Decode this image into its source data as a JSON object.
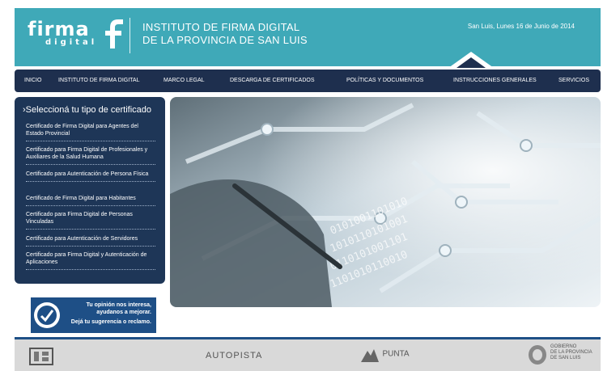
{
  "header": {
    "logo_main": "firma",
    "logo_sub": "digital",
    "institute_line1": "INSTITUTO DE FIRMA DIGITAL",
    "institute_line2": "DE LA PROVINCIA DE SAN LUIS",
    "date": "San Luis, Lunes 16 de Junio de 2014"
  },
  "nav": {
    "items": [
      "INICIO",
      "INSTITUTO DE FIRMA DIGITAL",
      "MARCO LEGAL",
      "DESCARGA DE CERTIFICADOS",
      "POLÍTICAS Y DOCUMENTOS",
      "INSTRUCCIONES GENERALES",
      "SERVICIOS"
    ]
  },
  "sidebar": {
    "title": "Seleccioná tu tipo de certificado",
    "items": [
      "Certificado de Firma Digital para Agentes del Estado Provincial",
      "Certificado para Firma Digital de Profesionales y Auxiliares de la Salud Humana",
      "Certificado para Autenticación de Persona Física",
      "Certificado de Firma Digital para Habitantes",
      "Certificado para Firma Digital de Personas Vinculadas",
      "Certificado para Autenticación de Servidores",
      "Certificado para Firma Digital y Autenticación de Aplicaciones"
    ]
  },
  "survey": {
    "line1": "Tu opinión nos interesa,",
    "line2": "ayudanos a mejorar.",
    "line3": "Dejá tu sugerencia o reclamo."
  },
  "footer": {
    "logos": [
      "CPE",
      "AUTOPISTA",
      "PUNTA",
      "GOBIERNO DE LA PROVINCIA DE SAN LUIS"
    ],
    "autopista_label": "AUTOPISTA",
    "punta_label": "PUNTA",
    "gob_line1": "GOBIERNO",
    "gob_line2": "DE LA PROVINCIA",
    "gob_line3": "DE SAN LUIS"
  },
  "colors": {
    "header": "#3fa9b8",
    "nav": "#1e2f4e",
    "sidebar": "#1e3657",
    "survey": "#1e4f86",
    "footer": "#d9d9d9"
  }
}
